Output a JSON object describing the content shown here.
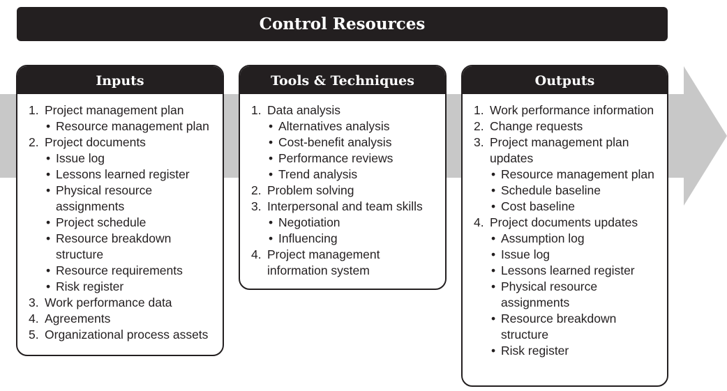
{
  "title": "Control Resources",
  "colors": {
    "dark": "#231f20",
    "arrow": "#c8c8c8",
    "background": "#ffffff"
  },
  "inputs": {
    "header": "Inputs",
    "items": [
      {
        "num": "1.",
        "label": "Project management plan",
        "sub": [
          "Resource management plan"
        ]
      },
      {
        "num": "2.",
        "label": "Project documents",
        "sub": [
          "Issue log",
          "Lessons learned register",
          "Physical resource assignments",
          "Project schedule",
          "Resource breakdown structure",
          "Resource requirements",
          "Risk register"
        ]
      },
      {
        "num": "3.",
        "label": "Work performance data",
        "sub": []
      },
      {
        "num": "4.",
        "label": "Agreements",
        "sub": []
      },
      {
        "num": "5.",
        "label": "Organizational process assets",
        "sub": []
      }
    ]
  },
  "tools": {
    "header": "Tools & Techniques",
    "items": [
      {
        "num": "1.",
        "label": "Data analysis",
        "sub": [
          "Alternatives analysis",
          "Cost-benefit analysis",
          "Performance reviews",
          "Trend analysis"
        ]
      },
      {
        "num": "2.",
        "label": "Problem solving",
        "sub": []
      },
      {
        "num": "3.",
        "label": "Interpersonal and team skills",
        "sub": [
          "Negotiation",
          "Influencing"
        ]
      },
      {
        "num": "4.",
        "label": "Project management information system",
        "sub": []
      }
    ]
  },
  "outputs": {
    "header": "Outputs",
    "items": [
      {
        "num": "1.",
        "label": "Work performance information",
        "sub": []
      },
      {
        "num": "2.",
        "label": "Change requests",
        "sub": []
      },
      {
        "num": "3.",
        "label": "Project management plan updates",
        "sub": [
          "Resource management plan",
          "Schedule baseline",
          "Cost baseline"
        ]
      },
      {
        "num": "4.",
        "label": "Project documents updates",
        "sub": [
          "Assumption log",
          "Issue log",
          "Lessons learned register",
          "Physical resource assignments",
          "Resource breakdown structure",
          "Risk register"
        ]
      }
    ]
  }
}
